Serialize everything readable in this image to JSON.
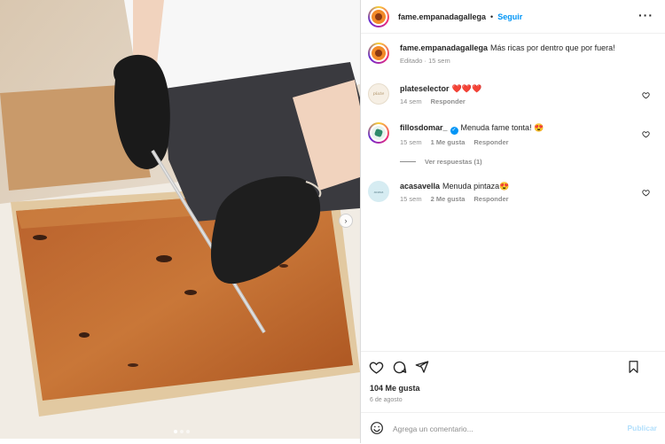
{
  "post": {
    "author": "fame.empanadagallega",
    "separator": "•",
    "follow_label": "Seguir",
    "more_icon": "more-icon",
    "caption": {
      "user": "fame.empanadagallega",
      "text": "Más ricas por dentro que por fuera!",
      "meta": "Editado · 15 sem"
    }
  },
  "comments": [
    {
      "user": "plateselector",
      "text": "❤️❤️❤️",
      "time": "14 sem",
      "likes": "",
      "reply": "Responder",
      "verified": false
    },
    {
      "user": "fillosdomar_",
      "text": "Menuda fame tonta! 😍",
      "time": "15 sem",
      "likes": "1 Me gusta",
      "reply": "Responder",
      "verified": true
    },
    {
      "user": "acasavella",
      "text": "Menuda pintaza😍",
      "time": "15 sem",
      "likes": "2 Me gusta",
      "reply": "Responder",
      "verified": false
    }
  ],
  "view_replies": "Ver respuestas (1)",
  "stats": {
    "likes": "104 Me gusta",
    "date": "6 de agosto"
  },
  "composer": {
    "placeholder": "Agrega un comentario...",
    "publish_label": "Publicar"
  },
  "carousel": {
    "current_slide": 1,
    "total_slides": 3
  },
  "colors": {
    "accent": "#0095f6",
    "muted": "#8e8e8e",
    "publish_disabled": "#b2dffc",
    "heart_red": "#ed4956"
  }
}
